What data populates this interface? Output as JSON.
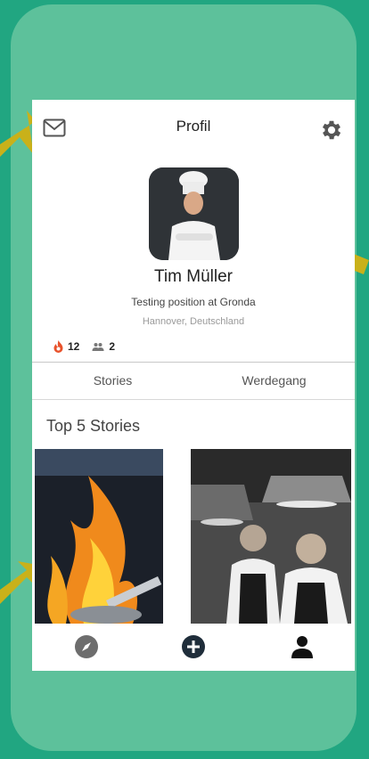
{
  "header": {
    "title": "Profil",
    "left_icon": "mail-icon",
    "right_icon": "gear-icon"
  },
  "profile": {
    "name": "Tim Müller",
    "position": "Testing position at Gronda",
    "location": "Hannover, Deutschland",
    "stats": [
      {
        "icon": "flame-icon",
        "value": "12"
      },
      {
        "icon": "people-icon",
        "value": "2"
      }
    ]
  },
  "tabs": [
    {
      "label": "Stories"
    },
    {
      "label": "Werdegang"
    }
  ],
  "section": {
    "title": "Top 5 Stories"
  },
  "bottom_nav": [
    {
      "icon": "compass-icon"
    },
    {
      "icon": "add-icon"
    },
    {
      "icon": "person-icon"
    }
  ],
  "colors": {
    "background": "#21a681",
    "device": "#5dc19b",
    "arrow": "#c9b11a",
    "flame": "#e8522b",
    "nav_dark": "#1f2d3a"
  }
}
